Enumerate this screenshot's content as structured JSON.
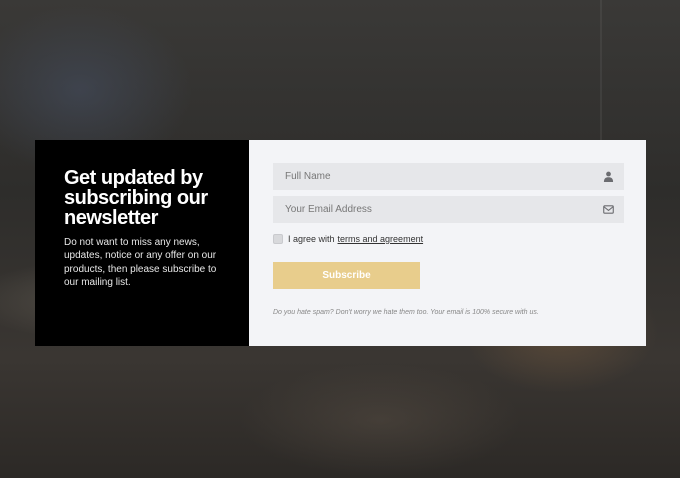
{
  "newsletter": {
    "title": "Get updated by subscribing our newsletter",
    "description": "Do not want to miss any news, updates, notice or any offer on our products, then please subscribe to our mailing list.",
    "full_name_placeholder": "Full Name",
    "email_placeholder": "Your Email Address",
    "agree_prefix": "I agree with",
    "agree_link": "terms and agreement",
    "subscribe_label": "Subscribe",
    "note": "Do you hate spam? Don't worry we hate them too. Your email is 100% secure with us.",
    "name_icon": "user-icon",
    "email_icon": "envelope-icon",
    "accent_color": "#e8cd8c"
  }
}
